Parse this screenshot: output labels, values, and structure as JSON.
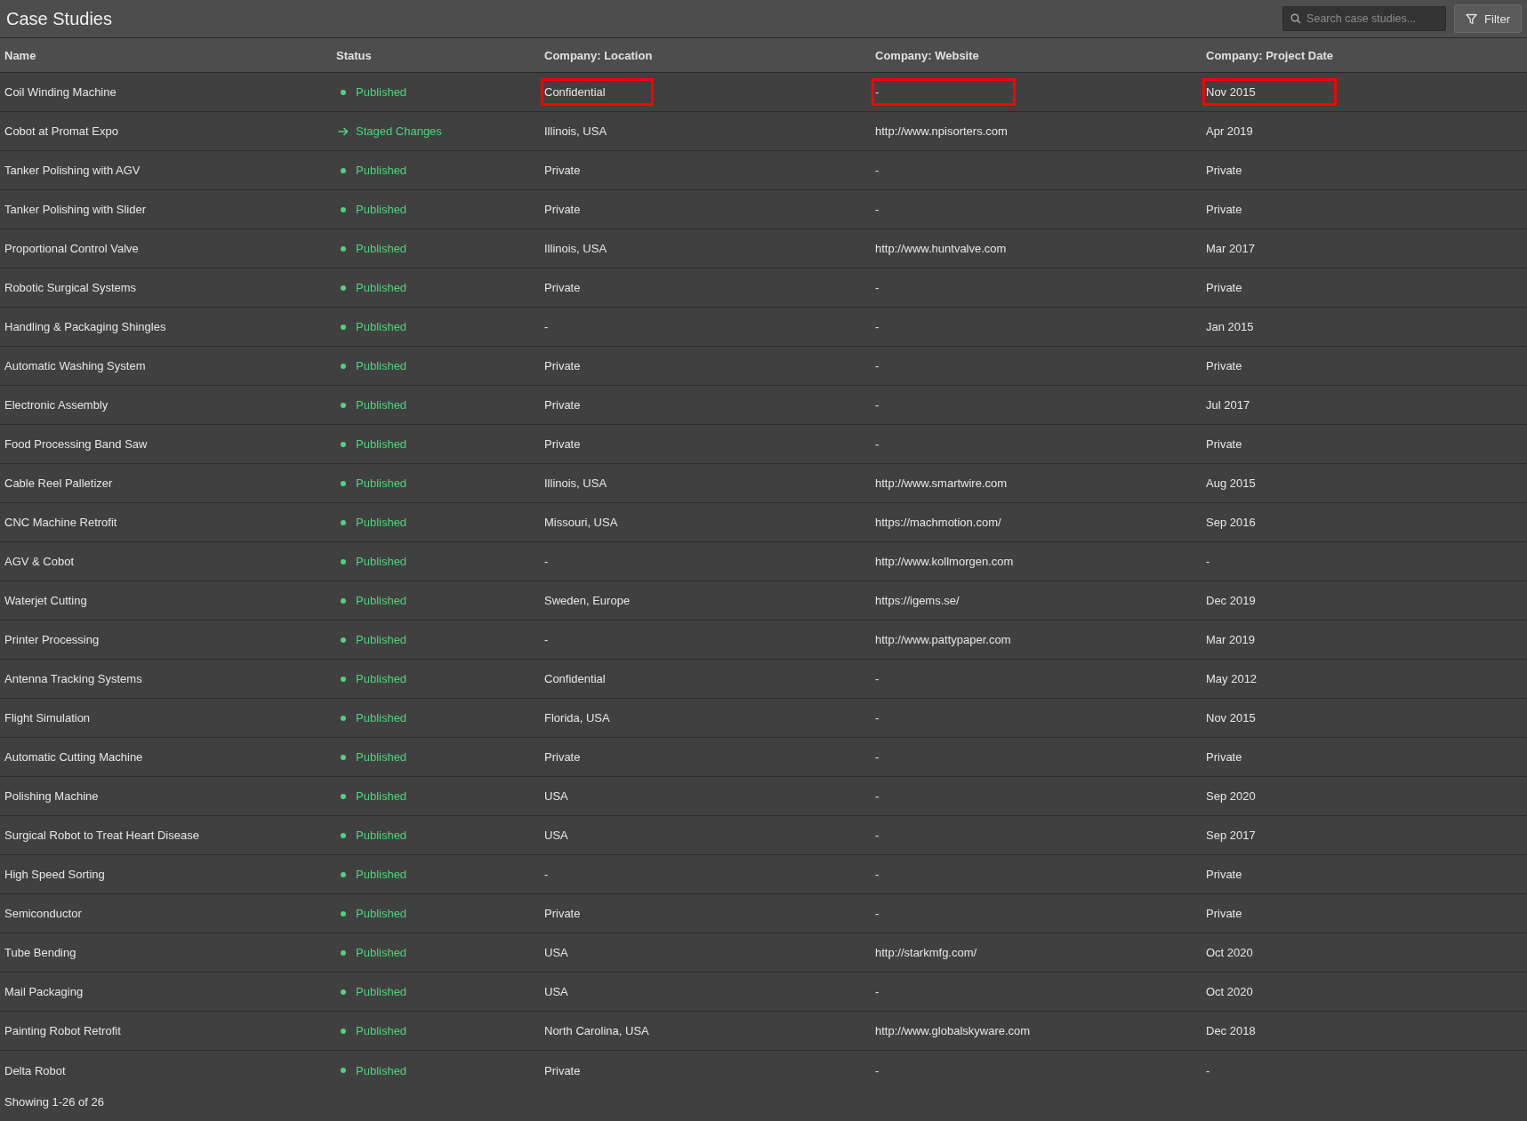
{
  "header": {
    "title": "Case Studies",
    "search": {
      "placeholder": "Search case studies..."
    },
    "filter_button": "Filter"
  },
  "table": {
    "columns": [
      "Name",
      "Status",
      "Company: Location",
      "Company: Website",
      "Company: Project Date"
    ],
    "rows": [
      {
        "name": "Coil Winding Machine",
        "status": {
          "kind": "published",
          "label": "Published"
        },
        "location": "Confidential",
        "website": "-",
        "date": "Nov 2015",
        "highlighted": true
      },
      {
        "name": "Cobot at Promat Expo",
        "status": {
          "kind": "staged",
          "label": "Staged Changes"
        },
        "location": "Illinois, USA",
        "website": "http://www.npisorters.com",
        "date": "Apr 2019",
        "highlighted": false
      },
      {
        "name": "Tanker Polishing with AGV",
        "status": {
          "kind": "published",
          "label": "Published"
        },
        "location": "Private",
        "website": "-",
        "date": "Private",
        "highlighted": false
      },
      {
        "name": "Tanker Polishing with Slider",
        "status": {
          "kind": "published",
          "label": "Published"
        },
        "location": "Private",
        "website": "-",
        "date": "Private",
        "highlighted": false
      },
      {
        "name": "Proportional Control Valve",
        "status": {
          "kind": "published",
          "label": "Published"
        },
        "location": "Illinois, USA",
        "website": "http://www.huntvalve.com",
        "date": "Mar 2017",
        "highlighted": false
      },
      {
        "name": "Robotic Surgical Systems",
        "status": {
          "kind": "published",
          "label": "Published"
        },
        "location": "Private",
        "website": "-",
        "date": "Private",
        "highlighted": false
      },
      {
        "name": "Handling & Packaging Shingles",
        "status": {
          "kind": "published",
          "label": "Published"
        },
        "location": "-",
        "website": "-",
        "date": "Jan 2015",
        "highlighted": false
      },
      {
        "name": "Automatic Washing System",
        "status": {
          "kind": "published",
          "label": "Published"
        },
        "location": "Private",
        "website": "-",
        "date": "Private",
        "highlighted": false
      },
      {
        "name": "Electronic Assembly",
        "status": {
          "kind": "published",
          "label": "Published"
        },
        "location": "Private",
        "website": "-",
        "date": "Jul 2017",
        "highlighted": false
      },
      {
        "name": "Food Processing Band Saw",
        "status": {
          "kind": "published",
          "label": "Published"
        },
        "location": "Private",
        "website": "-",
        "date": "Private",
        "highlighted": false
      },
      {
        "name": "Cable Reel Palletizer",
        "status": {
          "kind": "published",
          "label": "Published"
        },
        "location": "Illinois, USA",
        "website": "http://www.smartwire.com",
        "date": "Aug 2015",
        "highlighted": false
      },
      {
        "name": "CNC Machine Retrofit",
        "status": {
          "kind": "published",
          "label": "Published"
        },
        "location": "Missouri, USA",
        "website": "https://machmotion.com/",
        "date": "Sep 2016",
        "highlighted": false
      },
      {
        "name": "AGV & Cobot",
        "status": {
          "kind": "published",
          "label": "Published"
        },
        "location": "-",
        "website": "http://www.kollmorgen.com",
        "date": "-",
        "highlighted": false
      },
      {
        "name": "Waterjet Cutting",
        "status": {
          "kind": "published",
          "label": "Published"
        },
        "location": "Sweden, Europe",
        "website": "https://igems.se/",
        "date": "Dec 2019",
        "highlighted": false
      },
      {
        "name": "Printer Processing",
        "status": {
          "kind": "published",
          "label": "Published"
        },
        "location": "-",
        "website": "http://www.pattypaper.com",
        "date": "Mar 2019",
        "highlighted": false
      },
      {
        "name": "Antenna Tracking Systems",
        "status": {
          "kind": "published",
          "label": "Published"
        },
        "location": "Confidential",
        "website": "-",
        "date": "May 2012",
        "highlighted": false
      },
      {
        "name": "Flight Simulation",
        "status": {
          "kind": "published",
          "label": "Published"
        },
        "location": "Florida, USA",
        "website": "-",
        "date": "Nov 2015",
        "highlighted": false
      },
      {
        "name": "Automatic Cutting Machine",
        "status": {
          "kind": "published",
          "label": "Published"
        },
        "location": "Private",
        "website": "-",
        "date": "Private",
        "highlighted": false
      },
      {
        "name": "Polishing Machine",
        "status": {
          "kind": "published",
          "label": "Published"
        },
        "location": "USA",
        "website": "-",
        "date": "Sep 2020",
        "highlighted": false
      },
      {
        "name": "Surgical Robot to Treat Heart Disease",
        "status": {
          "kind": "published",
          "label": "Published"
        },
        "location": "USA",
        "website": "-",
        "date": "Sep 2017",
        "highlighted": false
      },
      {
        "name": "High Speed Sorting",
        "status": {
          "kind": "published",
          "label": "Published"
        },
        "location": "-",
        "website": "-",
        "date": "Private",
        "highlighted": false
      },
      {
        "name": "Semiconductor",
        "status": {
          "kind": "published",
          "label": "Published"
        },
        "location": "Private",
        "website": "-",
        "date": "Private",
        "highlighted": false
      },
      {
        "name": "Tube Bending",
        "status": {
          "kind": "published",
          "label": "Published"
        },
        "location": "USA",
        "website": "http://starkmfg.com/",
        "date": "Oct 2020",
        "highlighted": false
      },
      {
        "name": "Mail Packaging",
        "status": {
          "kind": "published",
          "label": "Published"
        },
        "location": "USA",
        "website": "-",
        "date": "Oct 2020",
        "highlighted": false
      },
      {
        "name": "Painting Robot Retrofit",
        "status": {
          "kind": "published",
          "label": "Published"
        },
        "location": "North Carolina, USA",
        "website": "http://www.globalskyware.com",
        "date": "Dec 2018",
        "highlighted": false
      },
      {
        "name": "Delta Robot",
        "status": {
          "kind": "published",
          "label": "Published"
        },
        "location": "Private",
        "website": "-",
        "date": "-",
        "highlighted": false
      }
    ]
  },
  "footer": "Showing 1-26 of 26"
}
